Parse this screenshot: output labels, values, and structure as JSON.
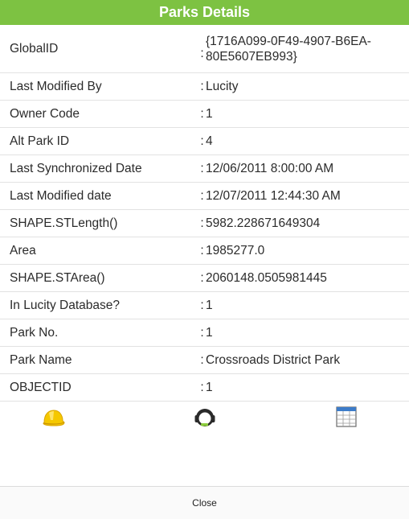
{
  "header": {
    "title": "Parks Details"
  },
  "rows": [
    {
      "label": "GlobalID",
      "value": "{1716A099-0F49-4907-B6EA-80E5607EB993}"
    },
    {
      "label": "Last Modified By",
      "value": "Lucity"
    },
    {
      "label": "Owner Code",
      "value": "1"
    },
    {
      "label": "Alt Park ID",
      "value": "4"
    },
    {
      "label": "Last Synchronized Date",
      "value": "12/06/2011 8:00:00 AM"
    },
    {
      "label": "Last Modified date",
      "value": "12/07/2011 12:44:30 AM"
    },
    {
      "label": "SHAPE.STLength()",
      "value": "5982.228671649304"
    },
    {
      "label": "Area",
      "value": "1985277.0"
    },
    {
      "label": "SHAPE.STArea()",
      "value": "2060148.0505981445"
    },
    {
      "label": "In Lucity Database?",
      "value": "1"
    },
    {
      "label": "Park No.",
      "value": "1"
    },
    {
      "label": "Park Name",
      "value": "Crossroads District Park"
    },
    {
      "label": "OBJECTID",
      "value": "1"
    }
  ],
  "icons": [
    {
      "name": "hardhat-icon",
      "color": "#f5c800"
    },
    {
      "name": "headset-icon",
      "color": "#2a2a2a"
    },
    {
      "name": "table-icon",
      "color": "#3d7cc9"
    }
  ],
  "footer": {
    "close_label": "Close"
  },
  "colors": {
    "header_bg": "#7dc242",
    "divider": "#e2e2e2"
  }
}
